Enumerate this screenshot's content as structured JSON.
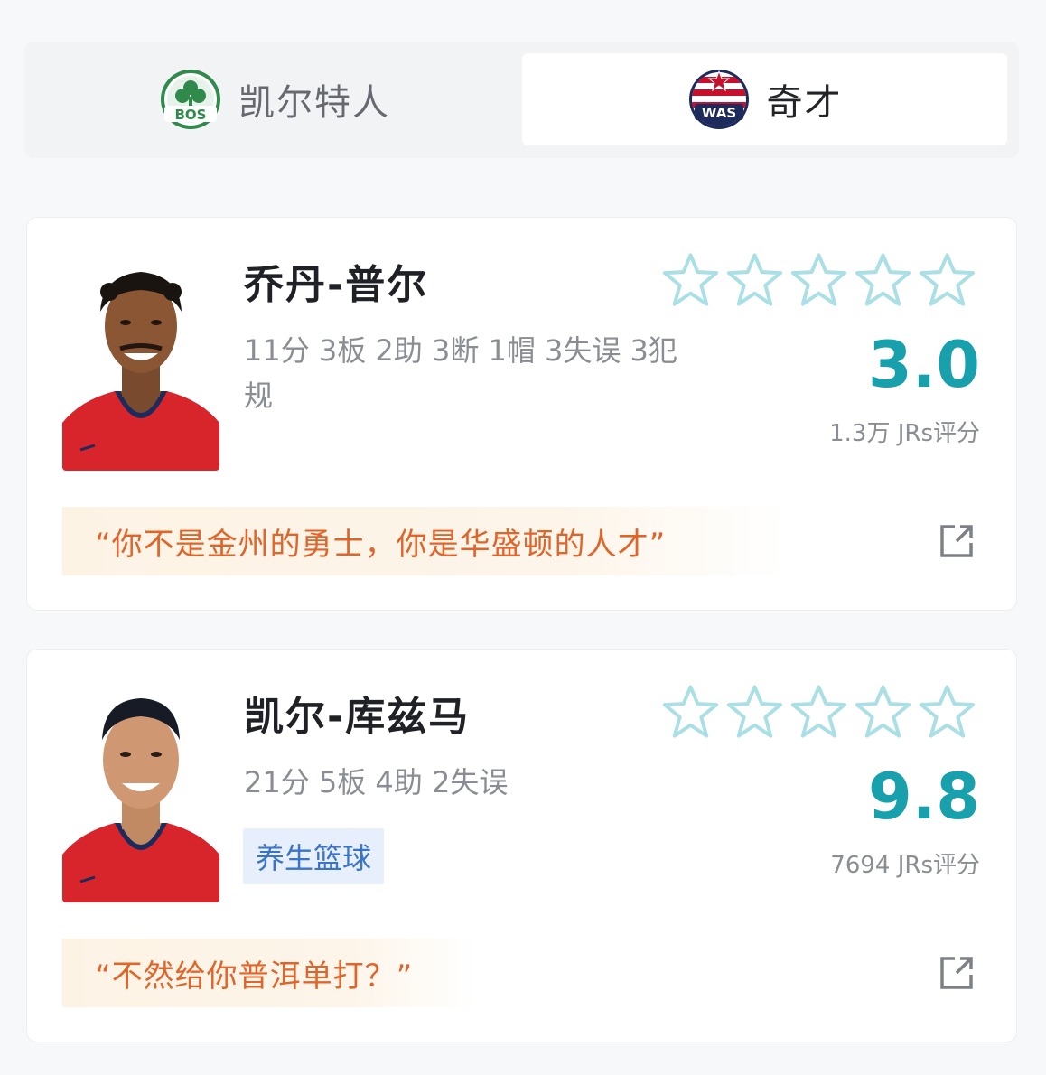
{
  "tabs": {
    "home": {
      "label": "凯尔特人",
      "abbr": "BOS"
    },
    "away": {
      "label": "奇才",
      "abbr": "WAS",
      "selected": true
    }
  },
  "players": [
    {
      "name": "乔丹-普尔",
      "stats": "11分 3板 2助 3断 1帽 3失误 3犯规",
      "score": "3.0",
      "raters": "1.3万 JRs评分",
      "quote": "“你不是金州的勇士，你是华盛顿的人才”",
      "stars": 5
    },
    {
      "name": "凯尔-库兹马",
      "stats": "21分 5板 4助 2失误",
      "tag": "养生篮球",
      "score": "9.8",
      "raters": "7694 JRs评分",
      "quote": "“不然给你普洱单打？”",
      "stars": 5
    }
  ],
  "colors": {
    "score": "#18a0ad",
    "quote": "#e0652b",
    "star_outline": "#a9dfe5",
    "tag_text": "#3a74c9",
    "tag_bg": "#e6effb"
  }
}
